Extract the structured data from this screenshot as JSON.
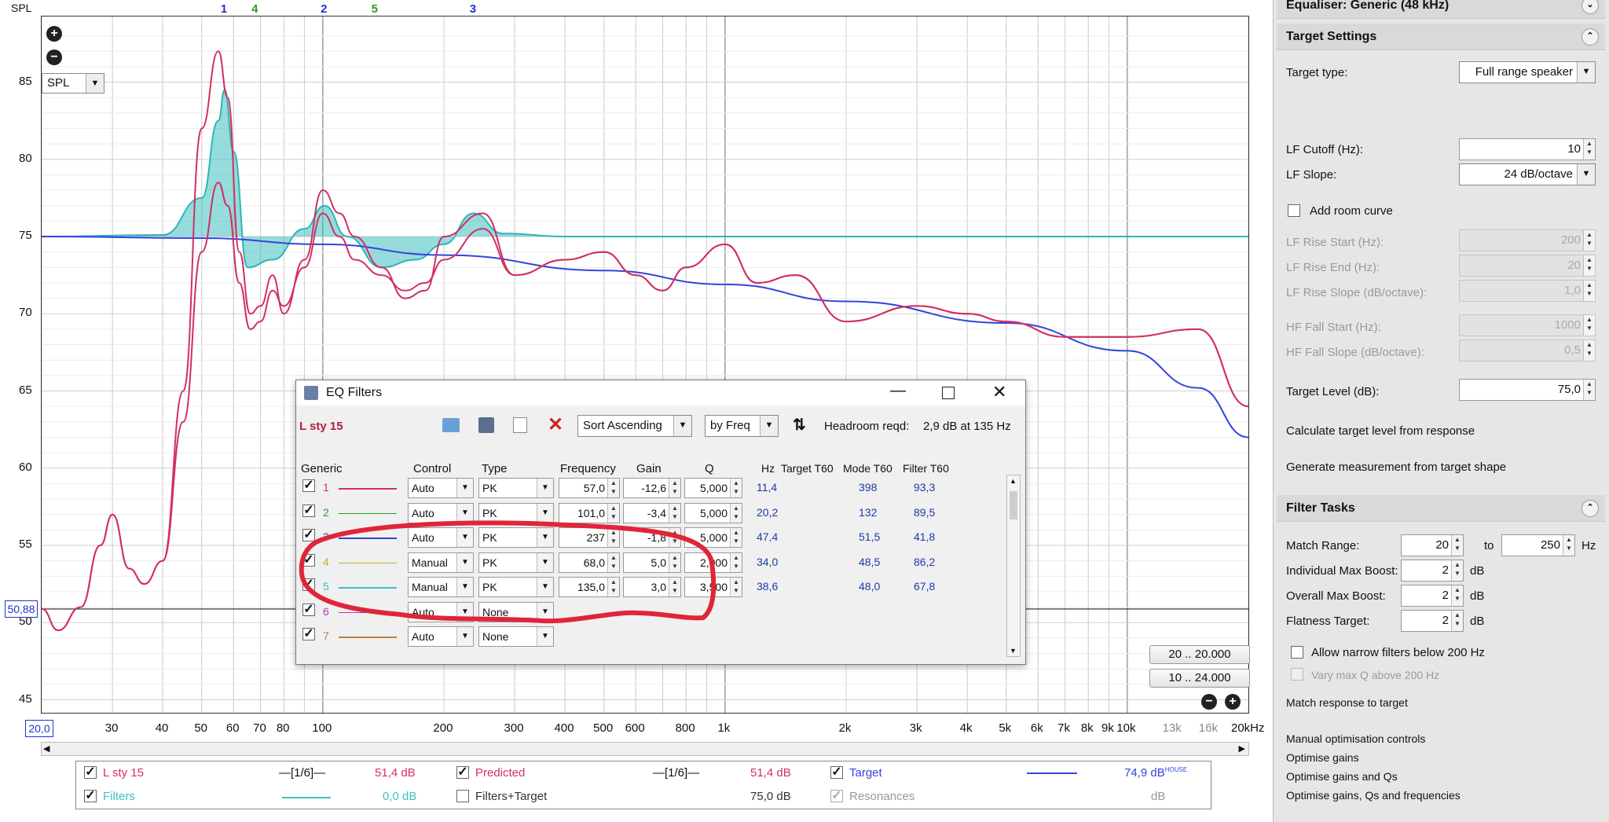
{
  "graph": {
    "y_axis_title": "SPL",
    "y_ticks": [
      "85",
      "80",
      "75",
      "70",
      "65",
      "60",
      "55",
      "50",
      "45"
    ],
    "x_ticks": [
      "30",
      "40",
      "50",
      "60",
      "70",
      "80",
      "100",
      "200",
      "300",
      "400",
      "500",
      "600",
      "800",
      "1k",
      "2k",
      "3k",
      "4k",
      "5k",
      "6k",
      "7k",
      "8k",
      "9k",
      "10k",
      "13k",
      "16k",
      "20kHz"
    ],
    "x_start_value": "20,0",
    "y_cursor_value": "50,88",
    "filter_markers": [
      {
        "label": "1",
        "color": "#2233cc"
      },
      {
        "label": "4",
        "color": "#2a9a2a"
      },
      {
        "label": "2",
        "color": "#2233cc"
      },
      {
        "label": "5",
        "color": "#2a9a2a"
      },
      {
        "label": "3",
        "color": "#2233cc"
      }
    ],
    "spl_select": "SPL",
    "range_buttons": [
      "20 .. 20.000",
      "10 .. 24.000"
    ]
  },
  "chart_data": {
    "type": "line",
    "xlabel": "",
    "ylabel": "SPL",
    "x_scale": "log",
    "xlim": [
      20,
      20000
    ],
    "ylim": [
      43,
      88
    ],
    "series": [
      {
        "name": "Target",
        "color": "#3344dd",
        "x": [
          20,
          50,
          100,
          200,
          500,
          1000,
          2000,
          5000,
          10000,
          15000,
          20000
        ],
        "y": [
          75.0,
          74.9,
          74.5,
          73.8,
          72.8,
          71.9,
          70.8,
          69.4,
          67.6,
          65.2,
          62.0
        ]
      },
      {
        "name": "L sty 15",
        "color": "#d03060",
        "x": [
          20,
          22,
          25,
          28,
          30,
          33,
          36,
          40,
          45,
          50,
          55,
          58,
          62,
          66,
          70,
          75,
          80,
          90,
          100,
          110,
          120,
          140,
          160,
          180,
          200,
          250,
          300,
          400,
          500,
          600,
          700,
          800,
          1000,
          1200,
          1500,
          2000,
          3000,
          4000,
          5000,
          7000,
          10000,
          15000,
          20000
        ],
        "y": [
          50.9,
          49.5,
          51.0,
          55.0,
          57.0,
          53.5,
          52.5,
          54.0,
          65.0,
          82.0,
          87.0,
          84.0,
          74.0,
          70.0,
          70.5,
          72.5,
          70.0,
          73.5,
          78.0,
          76.5,
          75.0,
          73.0,
          71.0,
          71.5,
          75.0,
          76.5,
          72.5,
          73.5,
          74.0,
          72.5,
          71.5,
          73.0,
          74.5,
          72.0,
          72.5,
          69.5,
          70.5,
          70.0,
          69.5,
          68.5,
          68.5,
          69.0,
          64.0
        ]
      },
      {
        "name": "Predicted",
        "color": "#d03060",
        "x": [
          20,
          22,
          25,
          28,
          30,
          33,
          36,
          40,
          45,
          50,
          55,
          58,
          62,
          66,
          70,
          75,
          80,
          90,
          100,
          110,
          120,
          140,
          160,
          180,
          200,
          250,
          300,
          400,
          500,
          600,
          700,
          800,
          1000,
          1200,
          1500,
          2000,
          3000,
          4000,
          5000,
          7000,
          10000,
          15000,
          20000
        ],
        "y": [
          50.9,
          49.5,
          51.0,
          55.0,
          57.0,
          53.5,
          52.5,
          54.0,
          63.0,
          74.0,
          78.5,
          77.0,
          72.0,
          69.0,
          69.5,
          71.5,
          70.5,
          73.0,
          76.5,
          75.0,
          73.5,
          72.5,
          71.5,
          72.0,
          73.5,
          75.5,
          72.5,
          73.5,
          74.0,
          72.5,
          71.5,
          73.0,
          74.5,
          72.0,
          72.5,
          69.5,
          70.5,
          70.0,
          69.5,
          68.5,
          68.5,
          69.0,
          64.0
        ]
      },
      {
        "name": "Filters",
        "color": "#40c0c0",
        "x": [
          20,
          40,
          50,
          55,
          57,
          60,
          65,
          75,
          90,
          101,
          115,
          140,
          170,
          200,
          237,
          280,
          400,
          20000
        ],
        "y": [
          75.0,
          75.1,
          77.5,
          82.5,
          84.5,
          80.5,
          73.0,
          73.5,
          75.5,
          77.0,
          75.0,
          73.0,
          73.5,
          74.5,
          76.5,
          75.2,
          75.0,
          75.0
        ]
      }
    ]
  },
  "eq": {
    "window_title": "EQ Filters",
    "measurement": "L sty 15",
    "sort": "Sort Ascending",
    "by": "by Freq",
    "headroom_label": "Headroom reqd:",
    "headroom_value": "2,9 dB at 135 Hz",
    "headers": {
      "generic": "Generic",
      "control": "Control",
      "type": "Type",
      "frequency": "Frequency",
      "gain": "Gain",
      "q": "Q",
      "hz": "Hz",
      "target_t60": "Target T60",
      "mode_t60": "Mode T60",
      "filter_t60": "Filter T60"
    },
    "rows": [
      {
        "n": "1",
        "color": "#d03060",
        "control": "Auto",
        "type": "PK",
        "freq": "57,0",
        "gain": "-12,6",
        "q": "5,000",
        "hz": "11,4",
        "target": "",
        "mode": "398",
        "filt": "93,3"
      },
      {
        "n": "2",
        "color": "#2a9a2a",
        "control": "Auto",
        "type": "PK",
        "freq": "101,0",
        "gain": "-3,4",
        "q": "5,000",
        "hz": "20,2",
        "target": "",
        "mode": "132",
        "filt": "89,5"
      },
      {
        "n": "3",
        "color": "#3344cc",
        "control": "Auto",
        "type": "PK",
        "freq": "237",
        "gain": "-1,8",
        "q": "5,000",
        "hz": "47,4",
        "target": "",
        "mode": "51,5",
        "filt": "41,8"
      },
      {
        "n": "4",
        "color": "#c8b020",
        "control": "Manual",
        "type": "PK",
        "freq": "68,0",
        "gain": "5,0",
        "q": "2,000",
        "hz": "34,0",
        "target": "",
        "mode": "48,5",
        "filt": "86,2"
      },
      {
        "n": "5",
        "color": "#40c0c0",
        "control": "Manual",
        "type": "PK",
        "freq": "135,0",
        "gain": "3,0",
        "q": "3,500",
        "hz": "38,6",
        "target": "",
        "mode": "48,0",
        "filt": "67,8"
      },
      {
        "n": "6",
        "color": "#b040b0",
        "control": "Auto",
        "type": "None",
        "freq": "",
        "gain": "",
        "q": "",
        "hz": "",
        "target": "",
        "mode": "",
        "filt": ""
      },
      {
        "n": "7",
        "color": "#c08040",
        "control": "Auto",
        "type": "None",
        "freq": "",
        "gain": "",
        "q": "",
        "hz": "",
        "target": "",
        "mode": "",
        "filt": ""
      }
    ]
  },
  "legend": {
    "row1": [
      {
        "name": "L sty 15",
        "smoothing": "1/6",
        "value": "51,4 dB",
        "color": "#d03060"
      },
      {
        "name": "Predicted",
        "smoothing": "1/6",
        "value": "51,4 dB",
        "color": "#d03060"
      },
      {
        "name": "Target",
        "value": "74,9 dB",
        "sup": "HOUSE",
        "color": "#3344dd"
      }
    ],
    "row2": [
      {
        "name": "Filters",
        "value": "0,0 dB",
        "color": "#40c0c0"
      },
      {
        "name": "Filters+Target",
        "value": "75,0 dB",
        "color": "#333333"
      },
      {
        "name": "Resonances",
        "value": "dB",
        "color": "#999999"
      }
    ]
  },
  "panel": {
    "equaliser_header": "Equaliser: Generic (48 kHz)",
    "target_header": "Target Settings",
    "target_type_label": "Target type:",
    "target_type_value": "Full range speaker",
    "lf_cutoff_label": "LF Cutoff (Hz):",
    "lf_cutoff_value": "10",
    "lf_slope_label": "LF Slope:",
    "lf_slope_value": "24 dB/octave",
    "add_room_curve": "Add room curve",
    "lf_rise_start_label": "LF Rise Start (Hz):",
    "lf_rise_start_value": "200",
    "lf_rise_end_label": "LF Rise End (Hz):",
    "lf_rise_end_value": "20",
    "lf_rise_slope_label": "LF Rise Slope (dB/octave):",
    "lf_rise_slope_value": "1,0",
    "hf_fall_start_label": "HF Fall Start (Hz):",
    "hf_fall_start_value": "1000",
    "hf_fall_slope_label": "HF Fall Slope (dB/octave):",
    "hf_fall_slope_value": "0,5",
    "target_level_label": "Target Level (dB):",
    "target_level_value": "75,0",
    "calc_target": "Calculate target level from response",
    "gen_measurement": "Generate measurement from target shape",
    "filter_tasks_header": "Filter Tasks",
    "match_range_label": "Match Range:",
    "match_range_from": "20",
    "match_range_to_label": "to",
    "match_range_to": "250",
    "match_range_unit": "Hz",
    "indiv_boost_label": "Individual Max Boost:",
    "indiv_boost_value": "2",
    "overall_boost_label": "Overall Max Boost:",
    "overall_boost_value": "2",
    "flatness_label": "Flatness Target:",
    "flatness_value": "2",
    "db_unit": "dB",
    "allow_narrow": "Allow narrow filters below 200 Hz",
    "vary_max_q": "Vary max Q above 200 Hz",
    "match_response": "Match response to target",
    "manual_opt": "Manual optimisation controls",
    "opt_gains": "Optimise gains",
    "opt_gains_q": "Optimise gains and Qs",
    "opt_gains_q_f": "Optimise gains, Qs and frequencies"
  }
}
